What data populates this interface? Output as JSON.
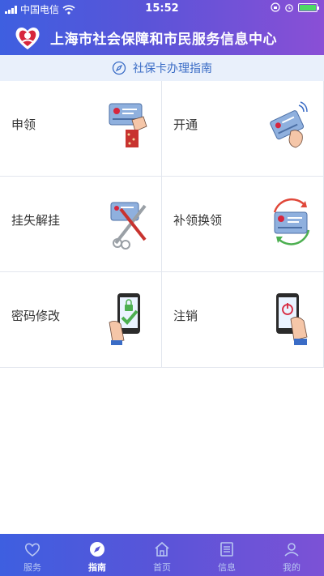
{
  "status_bar": {
    "carrier": "中国电信",
    "time": "15:52"
  },
  "header": {
    "title": "上海市社会保障和市民服务信息中心"
  },
  "guide_bar": {
    "title": "社保卡办理指南"
  },
  "menu": [
    {
      "label": "申领",
      "icon": "card-apply-icon"
    },
    {
      "label": "开通",
      "icon": "card-activate-icon"
    },
    {
      "label": "挂失解挂",
      "icon": "card-lost-icon"
    },
    {
      "label": "补领换领",
      "icon": "card-replace-icon"
    },
    {
      "label": "密码修改",
      "icon": "password-change-icon"
    },
    {
      "label": "注销",
      "icon": "card-cancel-icon"
    }
  ],
  "tabbar": {
    "active": "指南",
    "items": [
      {
        "label": "服务",
        "icon": "heart-icon"
      },
      {
        "label": "指南",
        "icon": "compass-icon"
      },
      {
        "label": "首页",
        "icon": "home-icon"
      },
      {
        "label": "信息",
        "icon": "list-icon"
      },
      {
        "label": "我的",
        "icon": "person-icon"
      }
    ]
  },
  "colors": {
    "header_start": "#3e5fe0",
    "header_end": "#8a4fd6",
    "guide_bar_bg": "#e9f0fb",
    "guide_text": "#3a6cc6",
    "battery": "#4cd964"
  }
}
